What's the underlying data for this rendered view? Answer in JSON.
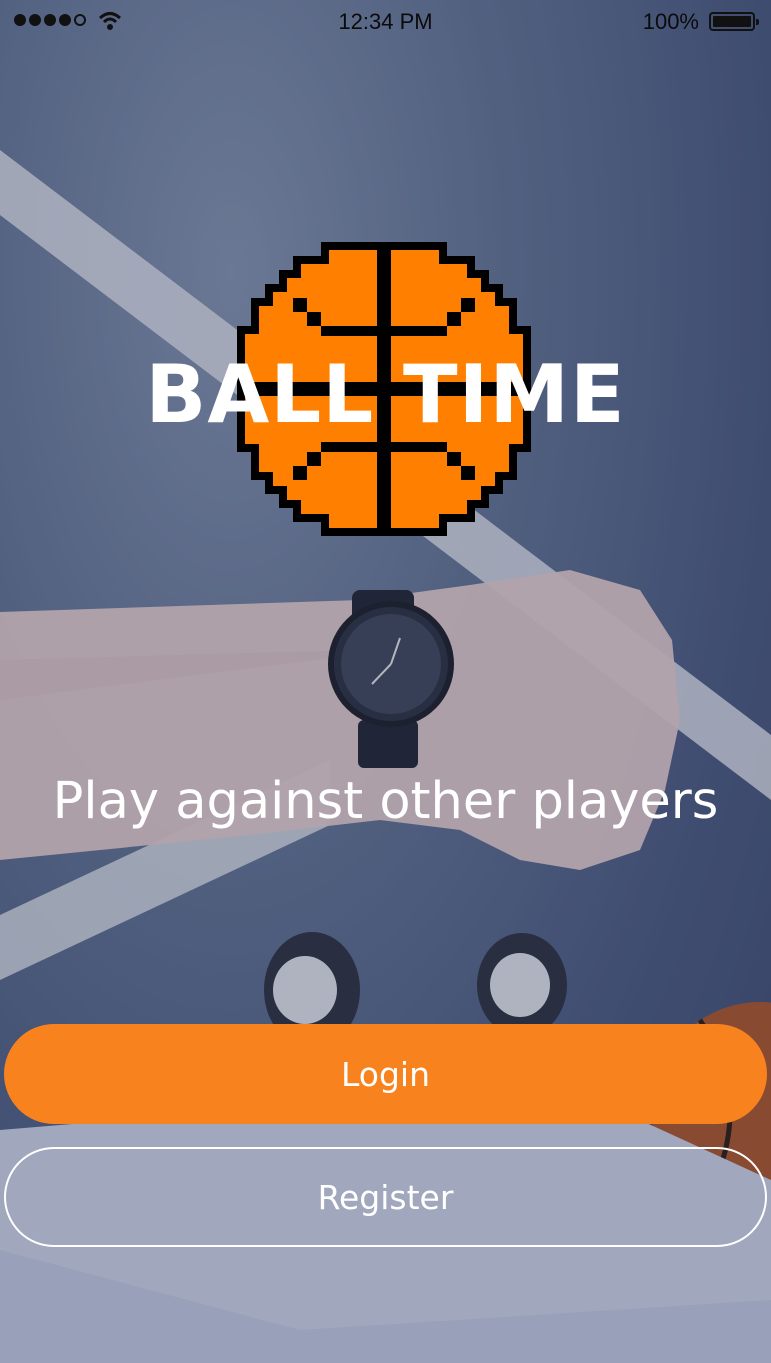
{
  "status_bar": {
    "time": "12:34 PM",
    "battery_percent": "100%",
    "signal_bars": 4,
    "signal_total": 5
  },
  "app": {
    "title": "BALL TIME",
    "tagline": "Play against other players",
    "logo_icon": "pixel-basketball-icon"
  },
  "buttons": {
    "login_label": "Login",
    "register_label": "Register"
  },
  "colors": {
    "accent": "#f8831e",
    "ball_orange": "#ff7f00",
    "text": "#ffffff"
  }
}
